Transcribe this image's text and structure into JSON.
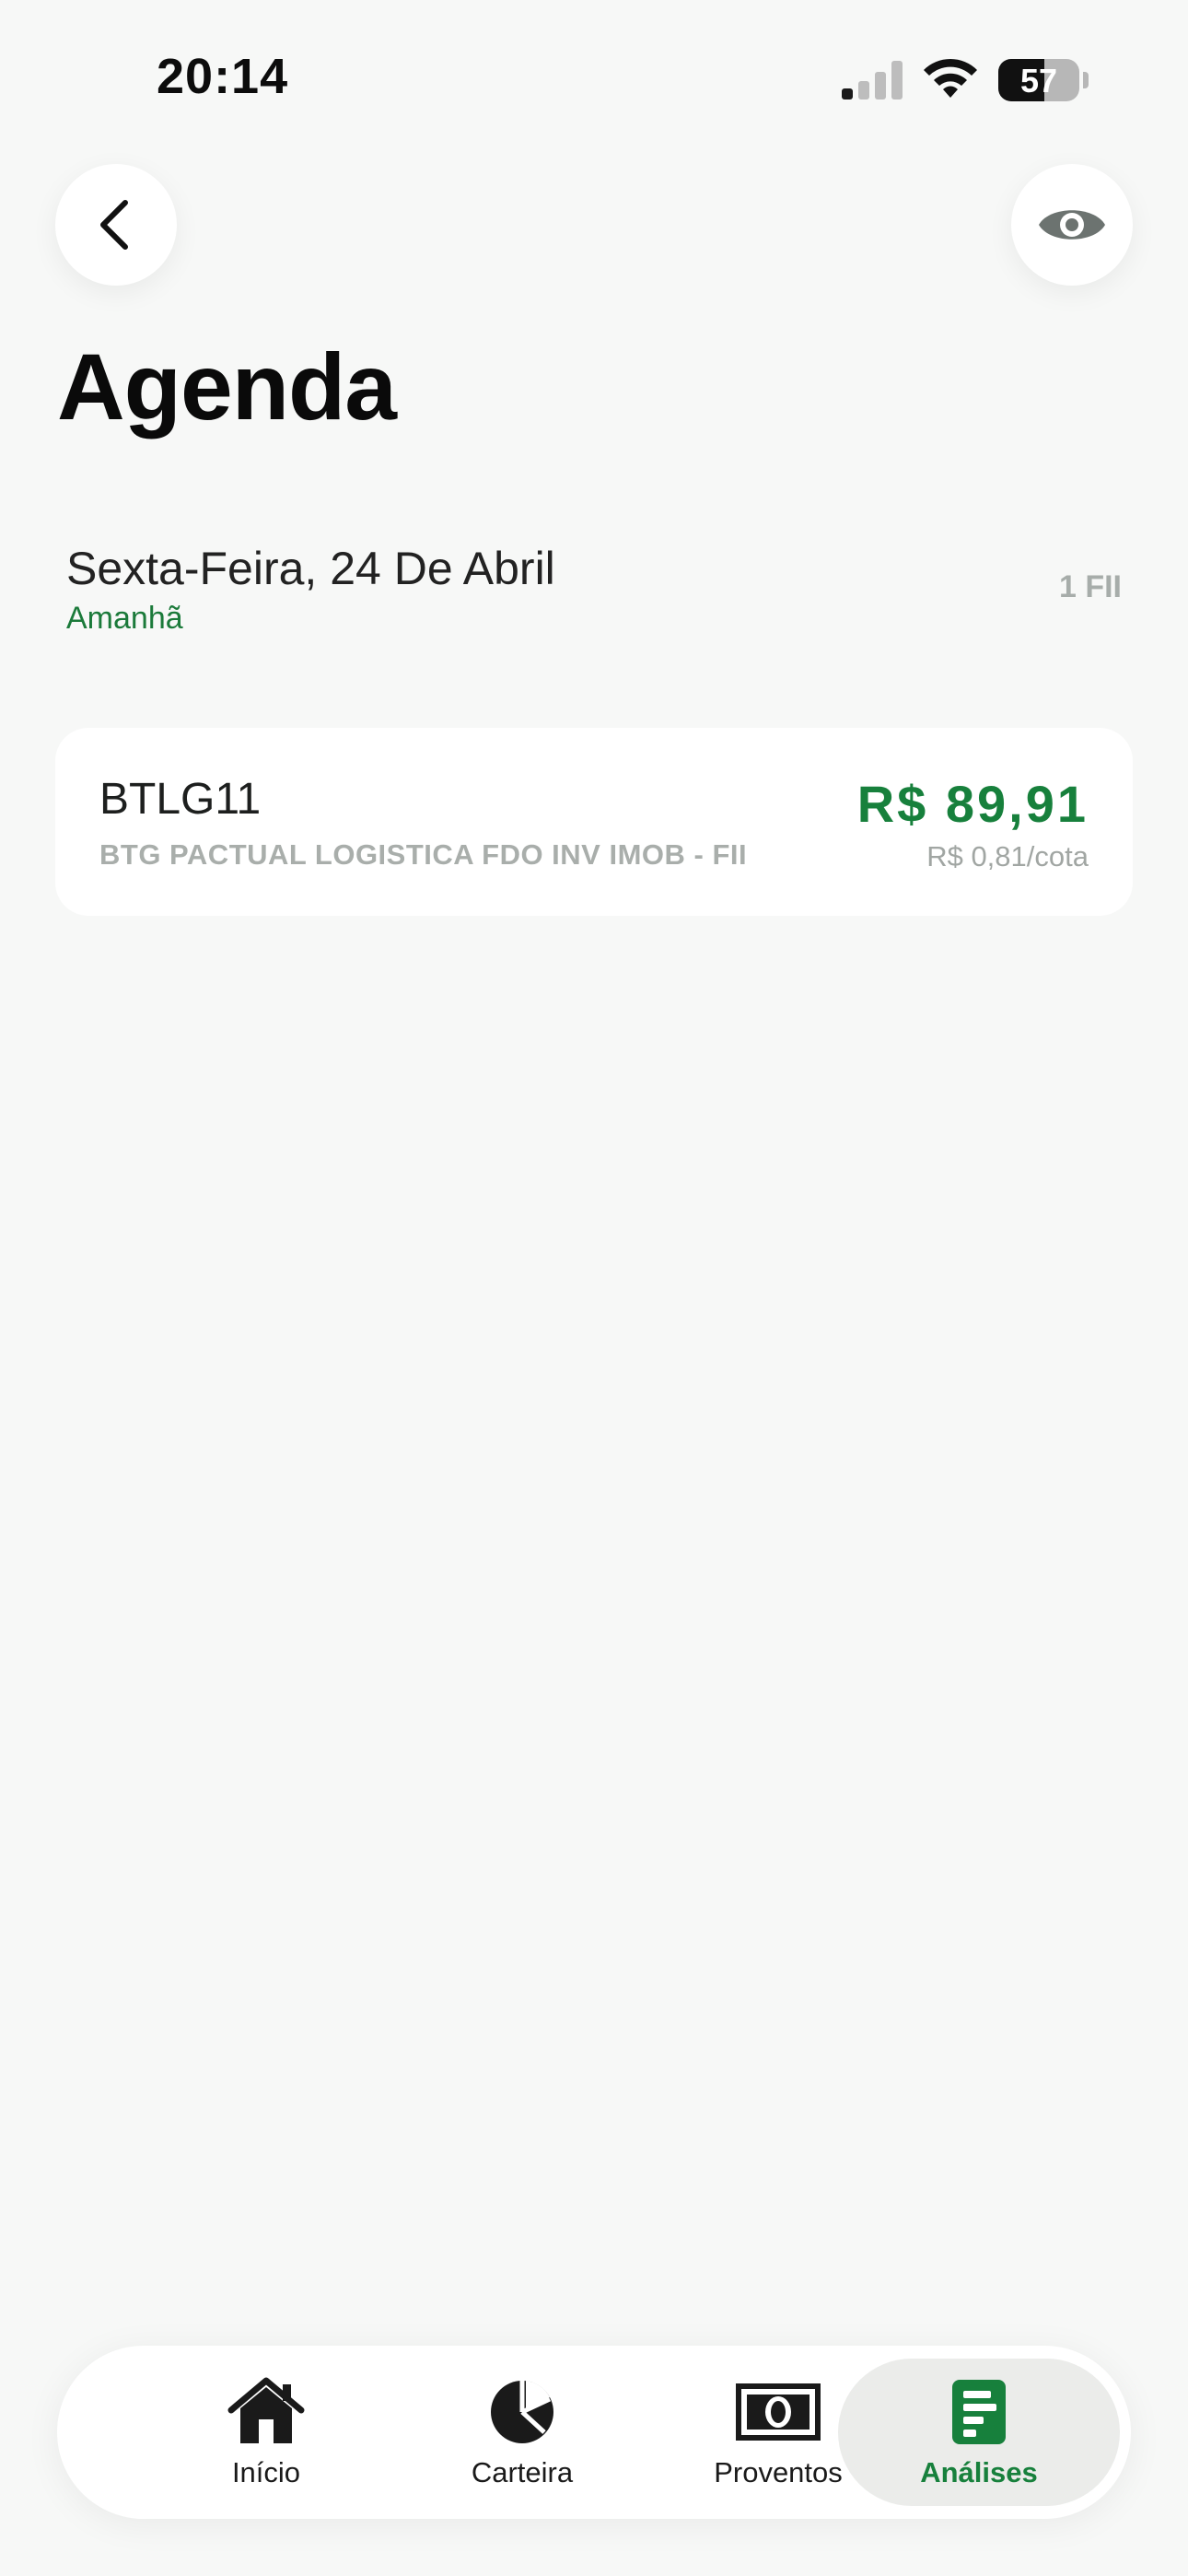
{
  "status_bar": {
    "time": "20:14",
    "battery": "57"
  },
  "header": {
    "back_icon": "chevron-left-icon",
    "visibility_icon": "eye-icon",
    "title": "Agenda"
  },
  "schedule": {
    "date": "Sexta-Feira, 24 De Abril",
    "relative_day": "Amanhã",
    "count": "1 FII",
    "items": [
      {
        "ticker": "BTLG11",
        "fund_name": "BTG PACTUAL LOGISTICA FDO INV IMOB - FII",
        "amount": "R$ 89,91",
        "per_share": "R$ 0,81/cota"
      }
    ]
  },
  "tab_bar": {
    "tabs": [
      {
        "label": "Início",
        "icon": "home-icon"
      },
      {
        "label": "Carteira",
        "icon": "pie-chart-icon"
      },
      {
        "label": "Proventos",
        "icon": "banknote-icon"
      },
      {
        "label": "Análises",
        "icon": "report-icon",
        "active": true
      }
    ]
  },
  "colors": {
    "accent_green": "#17803c",
    "background": "#f7f8f7",
    "muted_text": "#a9aeab"
  }
}
